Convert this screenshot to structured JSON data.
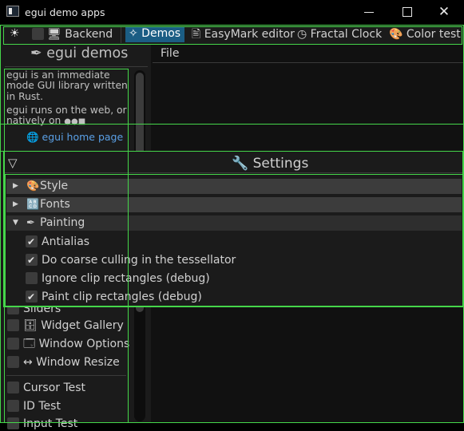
{
  "window": {
    "title": "egui demo apps",
    "minimize_glyph": "",
    "maximize_glyph": "",
    "close_glyph": "✕"
  },
  "top_bar": {
    "theme_icon": "☀",
    "backend_label": "🖥 Backend",
    "tabs": [
      {
        "label": "✧ Demos",
        "selected": true
      },
      {
        "label": "🖹 EasyMark editor",
        "selected": false
      },
      {
        "label": "◷ Fractal Clock",
        "selected": false
      },
      {
        "label": "🎨 Color test",
        "selected": false
      }
    ]
  },
  "side_panel": {
    "heading": "✒ egui demos",
    "about_lines": [
      "egui is an immediate",
      "mode GUI library written",
      "in Rust.",
      "egui runs on the web, or",
      "natively on  "
    ],
    "homepage_link": "🌐 egui home page",
    "demos": [
      {
        "label": "Sliders",
        "checked": false
      },
      {
        "label": "🗄 Widget Gallery",
        "checked": false
      },
      {
        "label": "🗔 Window Options",
        "checked": false
      },
      {
        "label": "↔ Window Resize",
        "checked": false
      }
    ],
    "tests": [
      {
        "label": "Cursor Test",
        "checked": false
      },
      {
        "label": "ID Test",
        "checked": false
      },
      {
        "label": "Input Test",
        "checked": false
      }
    ]
  },
  "central_panel": {
    "menu": [
      "File"
    ]
  },
  "settings_window": {
    "collapse_glyph": "▽",
    "title": "🔧 Settings",
    "sections": [
      {
        "label": "Style",
        "icon": "🎨",
        "open": false
      },
      {
        "label": "Fonts",
        "icon": "🔠",
        "open": false
      },
      {
        "label": "Painting",
        "icon": "✒",
        "open": true
      }
    ],
    "painting_options": [
      {
        "label": "Antialias",
        "checked": true
      },
      {
        "label": "Do coarse culling in the tessellator",
        "checked": true
      },
      {
        "label": "Ignore clip rectangles (debug)",
        "checked": false
      },
      {
        "label": "Paint clip rectangles (debug)",
        "checked": true
      }
    ]
  },
  "colors": {
    "debug_outline": "#45d64a",
    "selected_tab": "#1b5d84",
    "link": "#5aa0e6"
  }
}
